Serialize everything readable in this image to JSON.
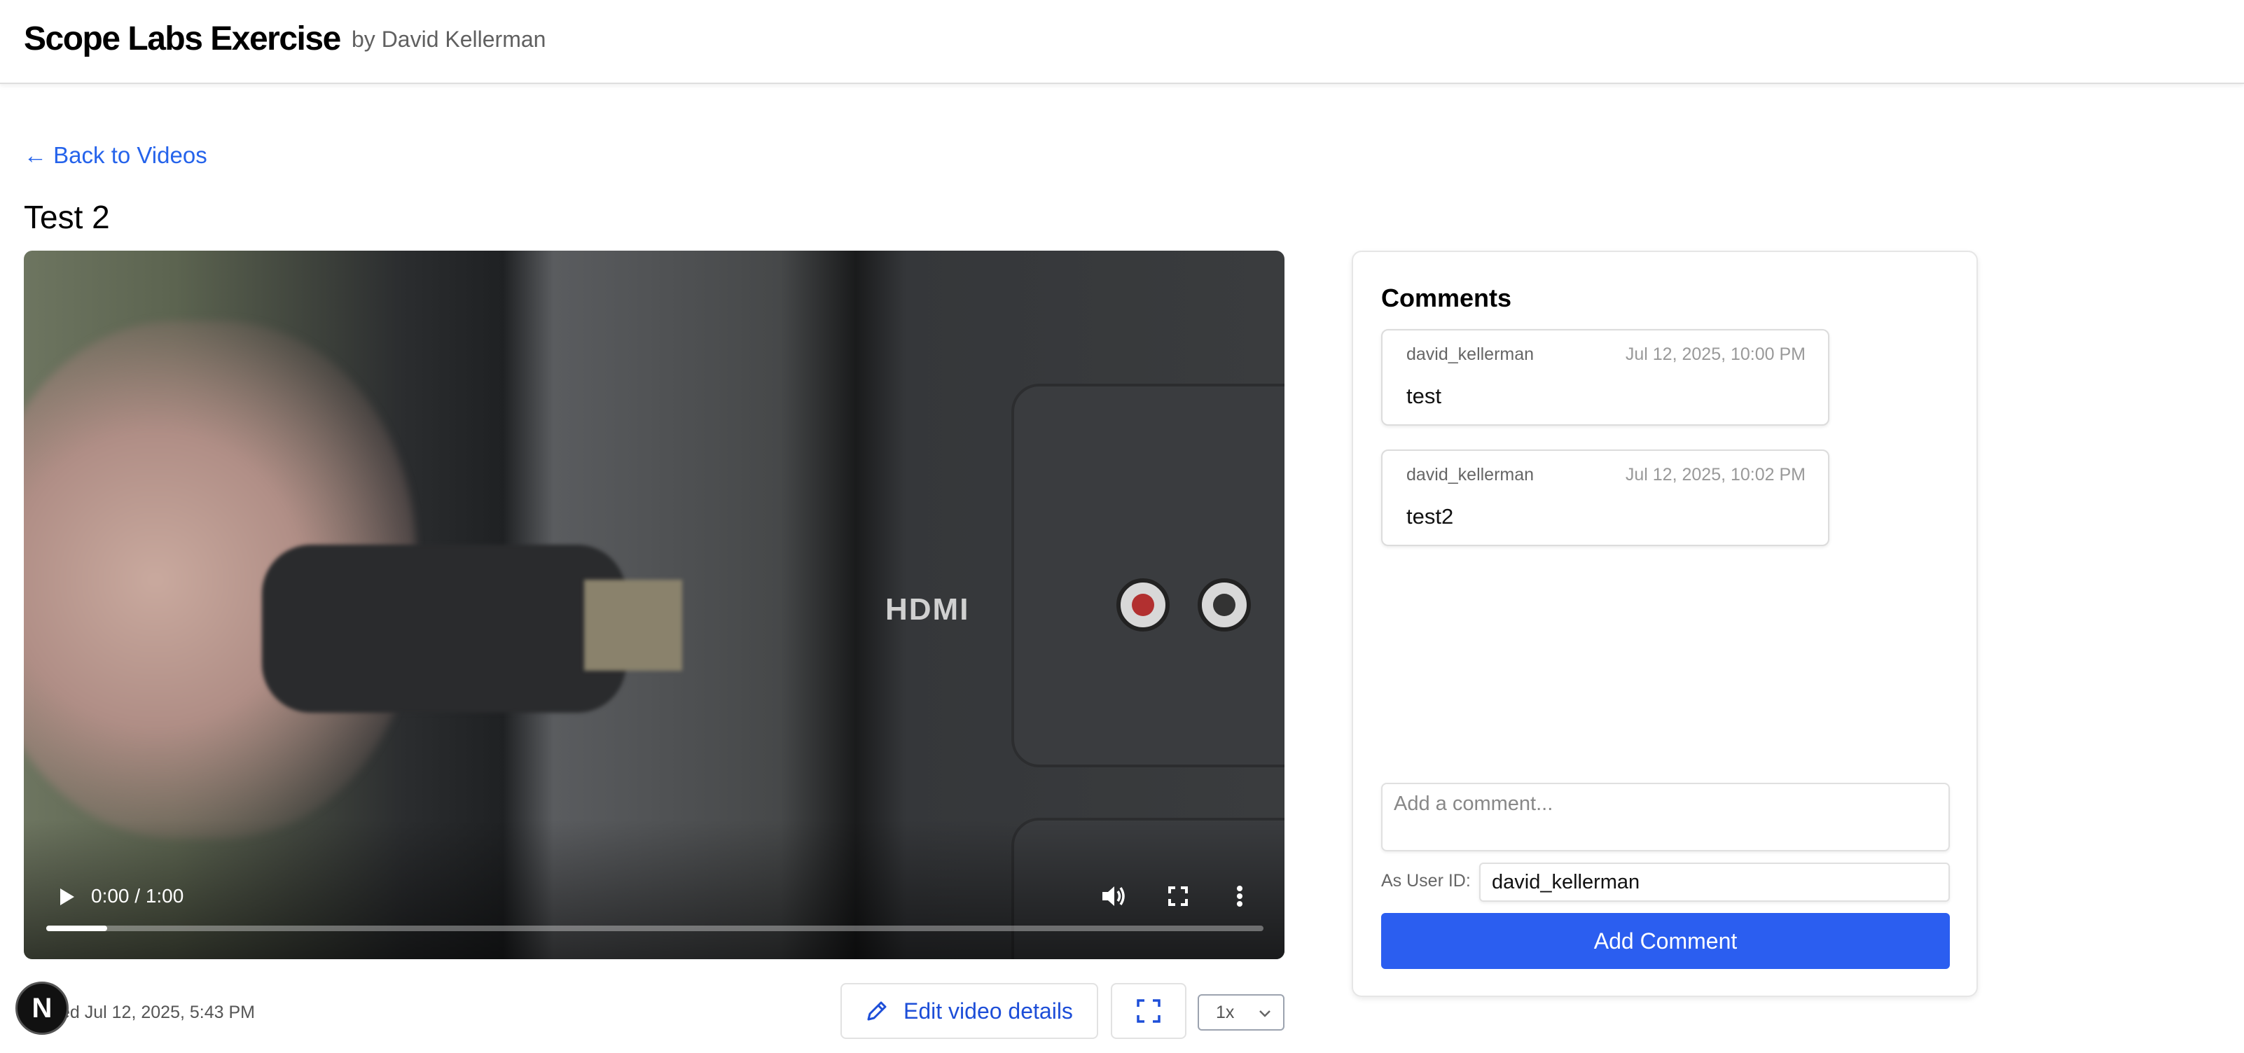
{
  "header": {
    "app_title": "Scope Labs Exercise",
    "author": "by David Kellerman"
  },
  "nav": {
    "back_label": "← Back to Videos"
  },
  "video": {
    "title": "Test 2",
    "time_display": "0:00 / 1:00",
    "progress_fraction": 0.05,
    "overlay_text": "HDMI",
    "created_text": "ed Jul 12, 2025, 5:43 PM",
    "edit_label": "Edit video details",
    "speed": "1x"
  },
  "comments": {
    "title": "Comments",
    "items": [
      {
        "user": "david_kellerman",
        "timestamp": "Jul 12, 2025, 10:00 PM",
        "text": "test"
      },
      {
        "user": "david_kellerman",
        "timestamp": "Jul 12, 2025, 10:02 PM",
        "text": "test2"
      }
    ],
    "input_placeholder": "Add a comment...",
    "user_id_label": "As User ID:",
    "user_id_value": "david_kellerman",
    "submit_label": "Add Comment"
  },
  "badge": {
    "letter": "N"
  },
  "colors": {
    "accent": "#2563eb",
    "button": "#2b5ef0"
  }
}
